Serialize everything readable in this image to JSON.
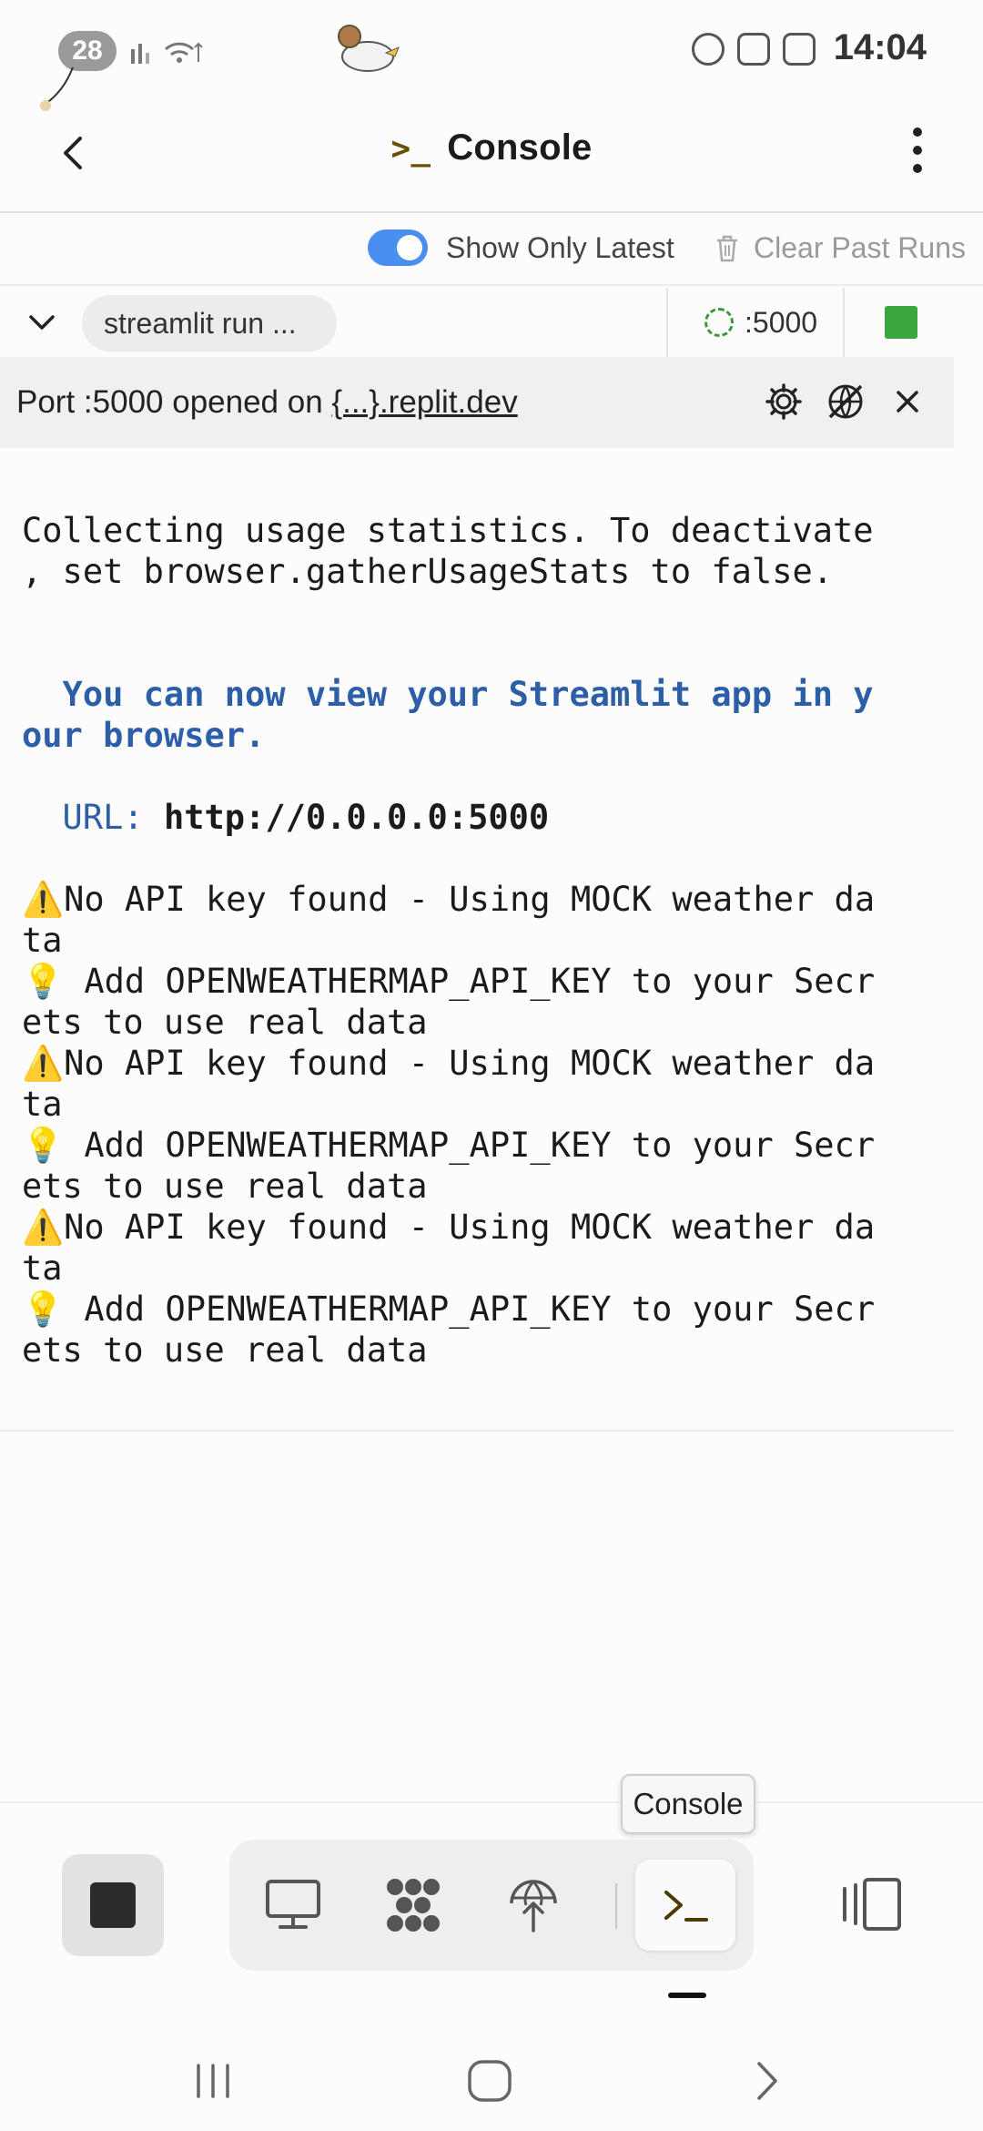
{
  "status_bar": {
    "notification_count": "28",
    "time": "14:04"
  },
  "header": {
    "title": "Console",
    "prompt_glyph": ">_"
  },
  "toolbar": {
    "toggle_label": "Show Only Latest",
    "toggle_on": true,
    "clear_label": "Clear Past Runs"
  },
  "run": {
    "command_chip": "streamlit run ...",
    "port_label": ":5000",
    "status_color": "#3aa640"
  },
  "banner": {
    "text_prefix": "Port :5000 opened on ",
    "link_text": "{...}.replit.dev"
  },
  "console": {
    "line1": "Collecting usage statistics. To deactivate",
    "line2": ", set browser.gatherUsageStats to false.",
    "line3": "  You can now view your Streamlit app in y",
    "line4": "our browser.",
    "url_label": "  URL: ",
    "url_value": "http://0.0.0.0:5000",
    "warn_a1": "⚠️No API key found - Using MOCK weather da",
    "warn_a2": "ta",
    "tip_a1": "💡 Add OPENWEATHERMAP_API_KEY to your Secr",
    "tip_a2": "ets to use real data",
    "warn_b1": "⚠️No API key found - Using MOCK weather da",
    "warn_b2": "ta",
    "tip_b1": "💡 Add OPENWEATHERMAP_API_KEY to your Secr",
    "tip_b2": "ets to use real data",
    "warn_c1": "⚠️No API key found - Using MOCK weather da",
    "warn_c2": "ta",
    "tip_c1": "💡 Add OPENWEATHERMAP_API_KEY to your Secr",
    "tip_c2": "ets to use real data"
  },
  "tooltip": {
    "text": "Console"
  },
  "colors": {
    "accent_blue": "#4a8ff0",
    "console_highlight": "#2d5fa8"
  }
}
